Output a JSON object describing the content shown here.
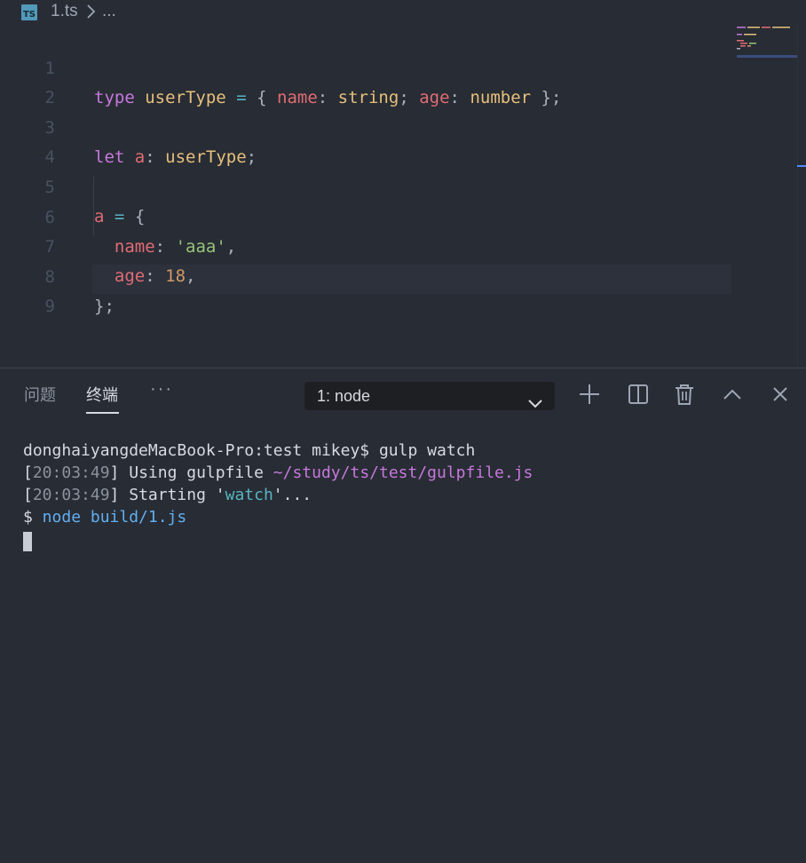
{
  "breadcrumb": {
    "file_icon": "typescript-file-icon",
    "file_icon_text": "TS",
    "file_name": "1.ts",
    "separator_icon": "chevron-right-icon",
    "more": "..."
  },
  "editor": {
    "lines": [
      {
        "number": "1",
        "text": "type userType = { name: string; age: number };"
      },
      {
        "number": "2",
        "text": ""
      },
      {
        "number": "3",
        "text": "let a: userType;"
      },
      {
        "number": "4",
        "text": ""
      },
      {
        "number": "5",
        "text": "a = {"
      },
      {
        "number": "6",
        "text": "  name: 'aaa',"
      },
      {
        "number": "7",
        "text": "  age: 18,"
      },
      {
        "number": "8",
        "text": "};"
      },
      {
        "number": "9",
        "text": ""
      }
    ],
    "tokens": {
      "l1": [
        "type",
        " ",
        "userType",
        " ",
        "=",
        " ",
        "{",
        " ",
        "name",
        ":",
        " ",
        "string",
        ";",
        " ",
        "age",
        ":",
        " ",
        "number",
        " ",
        "}",
        ";"
      ],
      "l3": [
        "let",
        " ",
        "a",
        ":",
        " ",
        "userType",
        ";"
      ],
      "l5": [
        "a",
        " ",
        "=",
        " ",
        "{"
      ],
      "l6": [
        "  ",
        "name",
        ":",
        " ",
        "'aaa'",
        ","
      ],
      "l7": [
        "  ",
        "age",
        ":",
        " ",
        "18",
        ","
      ],
      "l8": [
        "}",
        ";"
      ]
    },
    "current_line": "9"
  },
  "panel": {
    "tabs": [
      {
        "label": "问题",
        "active": false
      },
      {
        "label": "终端",
        "active": true
      }
    ],
    "more_label": "···",
    "terminal_select": {
      "value": "1: node",
      "icon": "chevron-down-icon"
    },
    "actions": [
      "plus-icon",
      "split-icon",
      "trash-icon",
      "chevron-up-icon",
      "close-icon"
    ]
  },
  "terminal": {
    "line1": "donghaiyangdeMacBook-Pro:test mikey$ gulp watch",
    "line2": {
      "open": "[",
      "time": "20:03:49",
      "close": "]",
      "text": " Using gulpfile ",
      "path": "~/study/ts/test/gulpfile.js"
    },
    "line3": {
      "open": "[",
      "time": "20:03:49",
      "close": "]",
      "text": " Starting '",
      "task": "watch",
      "tail": "'..."
    },
    "line4": {
      "prompt": "$",
      "cmd": " node build/1.js"
    }
  },
  "colors": {
    "background": "#282c34",
    "keyword": "#c678dd",
    "type": "#e5c07b",
    "variable": "#e06c75",
    "string": "#98c379",
    "number": "#d19a66",
    "operator": "#56b6c2"
  }
}
